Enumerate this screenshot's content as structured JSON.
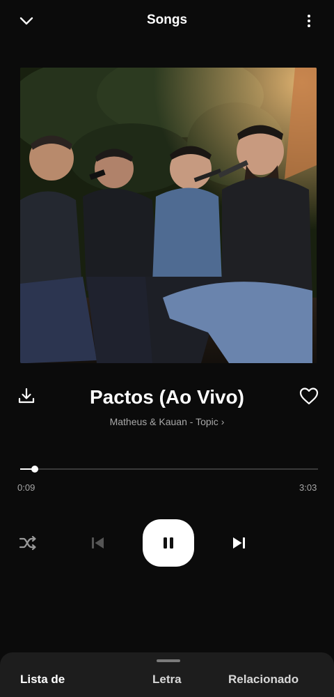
{
  "header": {
    "title": "Songs",
    "collapse_icon": "chevron-down-icon",
    "menu_icon": "more-vertical-icon"
  },
  "album_art": {
    "description_icon": "album-artwork"
  },
  "track": {
    "title": "Pactos (Ao Vivo)",
    "artist": "Matheus & Kauan - Topic",
    "artist_chevron": "›"
  },
  "playback": {
    "elapsed": "0:09",
    "duration": "3:03",
    "progress_fraction": 0.05
  },
  "controls": {
    "shuffle_icon": "shuffle-icon",
    "previous_icon": "skip-previous-icon",
    "play_pause_icon": "pause-icon",
    "next_icon": "skip-next-icon",
    "download_icon": "download-icon",
    "like_icon": "heart-icon"
  },
  "bottom_tabs": [
    {
      "label": "Lista de"
    },
    {
      "label": "Letra"
    },
    {
      "label": "Relacionado"
    }
  ],
  "colors": {
    "background": "#0b0b0b",
    "accent": "#ffffff",
    "muted_text": "#a8a8a8",
    "sheet": "#1d1d1d"
  }
}
